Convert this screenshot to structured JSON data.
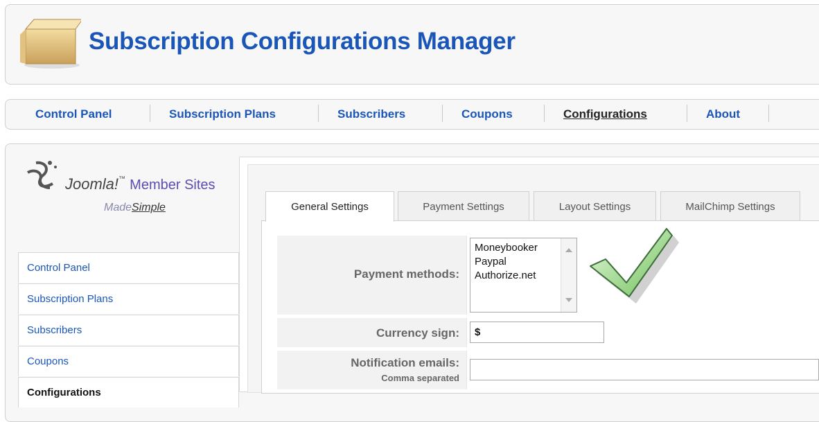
{
  "header": {
    "title": "Subscription Configurations Manager",
    "icon": "package-box-icon"
  },
  "topnav": {
    "items": [
      {
        "label": "Control Panel"
      },
      {
        "label": "Subscription Plans"
      },
      {
        "label": "Subscribers"
      },
      {
        "label": "Coupons"
      },
      {
        "label": "Configurations",
        "active": true
      },
      {
        "label": "About"
      }
    ]
  },
  "logo": {
    "brand": "Joomla!",
    "tm": "™",
    "product": "Member Sites",
    "made": "Made",
    "simple": "Simple"
  },
  "sidebar": {
    "items": [
      {
        "label": "Control Panel"
      },
      {
        "label": "Subscription Plans"
      },
      {
        "label": "Subscribers"
      },
      {
        "label": "Coupons"
      },
      {
        "label": "Configurations",
        "active": true
      }
    ]
  },
  "tabs": [
    {
      "label": "General Settings",
      "active": true
    },
    {
      "label": "Payment Settings"
    },
    {
      "label": "Layout Settings"
    },
    {
      "label": "MailChimp Settings"
    }
  ],
  "form": {
    "payment_methods": {
      "label": "Payment methods:",
      "options": [
        "Moneybooker",
        "Paypal",
        "Authorize.net"
      ]
    },
    "currency_sign": {
      "label": "Currency sign:",
      "value": "$"
    },
    "notification_emails": {
      "label": "Notification emails:",
      "sublabel": "Comma separated",
      "value": ""
    }
  },
  "colors": {
    "link": "#1a56b8",
    "check_green": "#7fcf6a"
  }
}
